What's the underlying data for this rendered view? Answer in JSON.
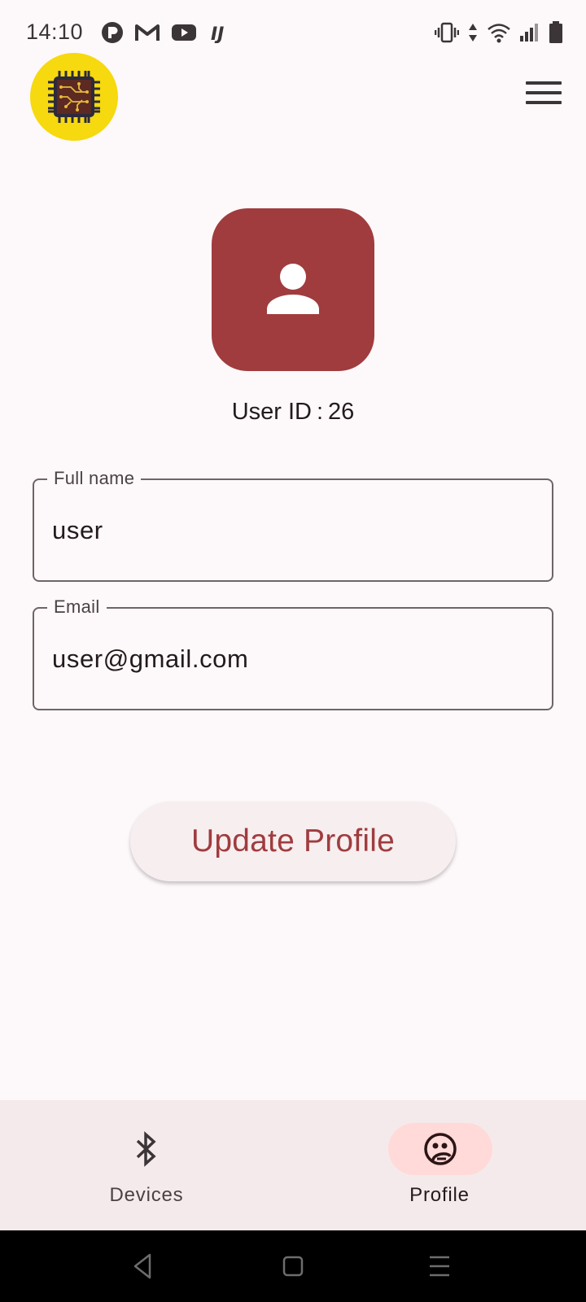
{
  "status_bar": {
    "time": "14:10",
    "left_icons": [
      "notification-r-icon",
      "gmail-icon",
      "youtube-icon",
      "intellij-icon"
    ],
    "right_icons": [
      "vibrate-icon",
      "data-arrows-icon",
      "wifi-icon",
      "signal-icon",
      "battery-icon"
    ]
  },
  "header": {
    "logo_icon": "circuit-chip-icon",
    "menu_icon": "hamburger-menu-icon"
  },
  "profile": {
    "avatar_icon": "person-icon",
    "user_id_label": "User ID",
    "user_id_separator": ":",
    "user_id_value": "26"
  },
  "form": {
    "full_name_label": "Full name",
    "full_name_value": "user",
    "email_label": "Email",
    "email_value": "user@gmail.com",
    "update_button_label": "Update Profile"
  },
  "bottom_nav": {
    "items": [
      {
        "label": "Devices",
        "icon": "bluetooth-icon",
        "selected": false
      },
      {
        "label": "Profile",
        "icon": "face-profile-icon",
        "selected": true
      }
    ]
  },
  "system_nav": {
    "buttons": [
      "back-icon",
      "home-icon",
      "recents-icon"
    ]
  },
  "colors": {
    "background": "#fdf8fa",
    "accent": "#a03c3e",
    "logo_yellow": "#f6d90e",
    "nav_background": "#f5eaeb",
    "nav_selected_pill": "#ffdad8",
    "button_background": "#f7eeef"
  }
}
